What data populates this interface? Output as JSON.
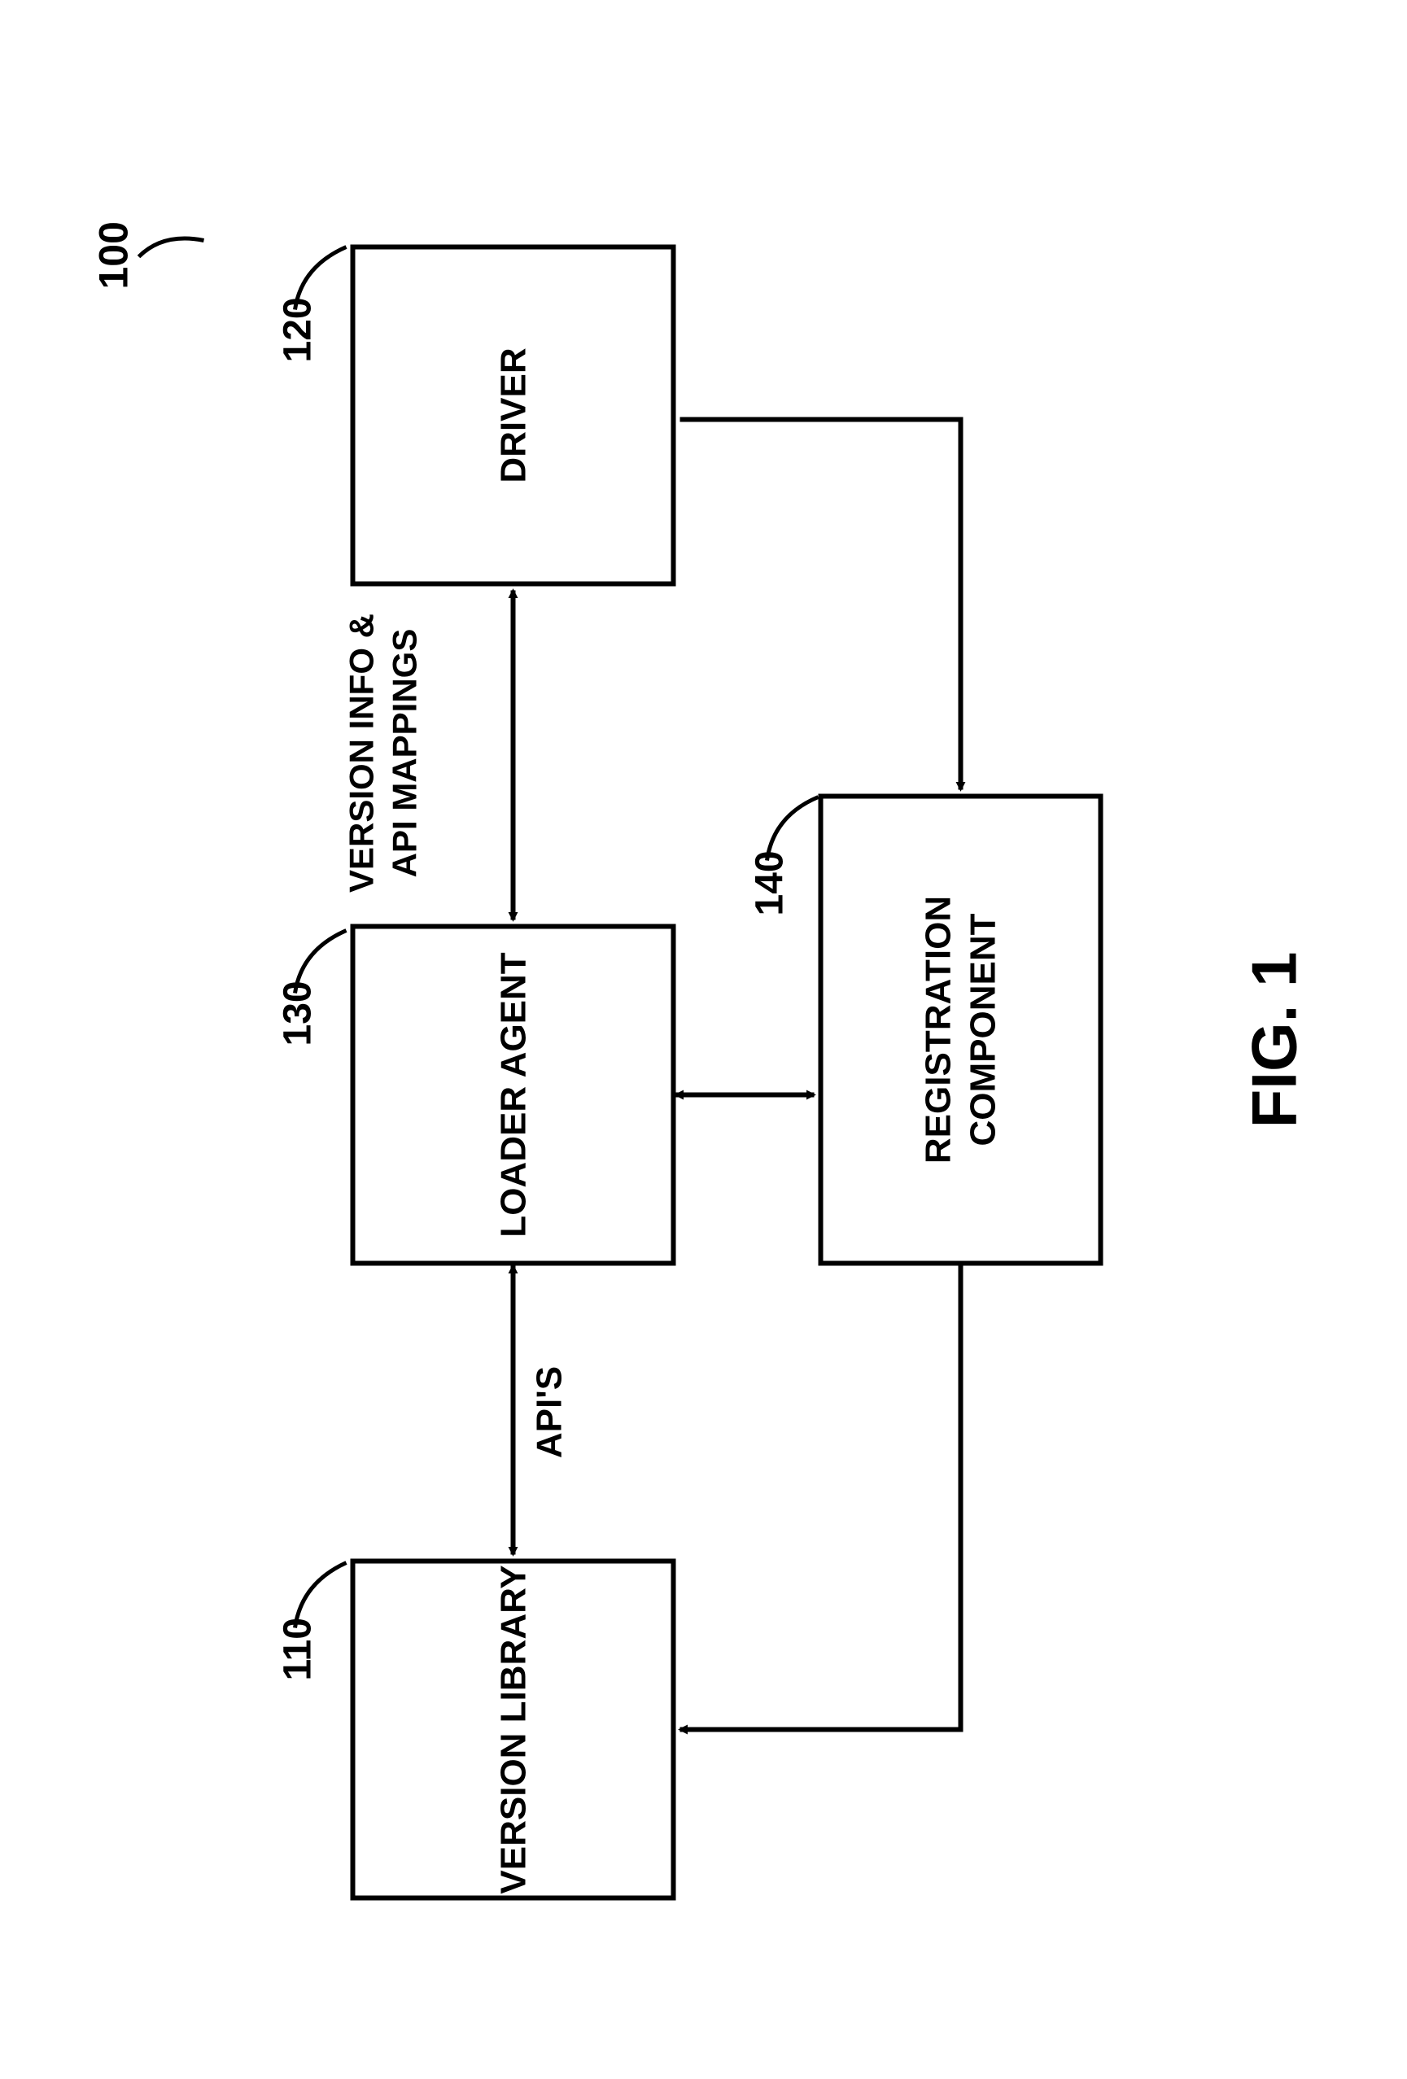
{
  "figure": {
    "system_ref": "100",
    "caption": "FIG. 1",
    "boxes": {
      "version_library": {
        "label": "VERSION LIBRARY",
        "ref": "110"
      },
      "loader_agent": {
        "label": "LOADER AGENT",
        "ref": "130"
      },
      "driver": {
        "label": "DRIVER",
        "ref": "120"
      },
      "registration_component": {
        "label": "REGISTRATION COMPONENT",
        "ref": "140"
      }
    },
    "connector_labels": {
      "apis": "API'S",
      "version_info_api_mappings": "VERSION INFO & API MAPPINGS"
    }
  }
}
